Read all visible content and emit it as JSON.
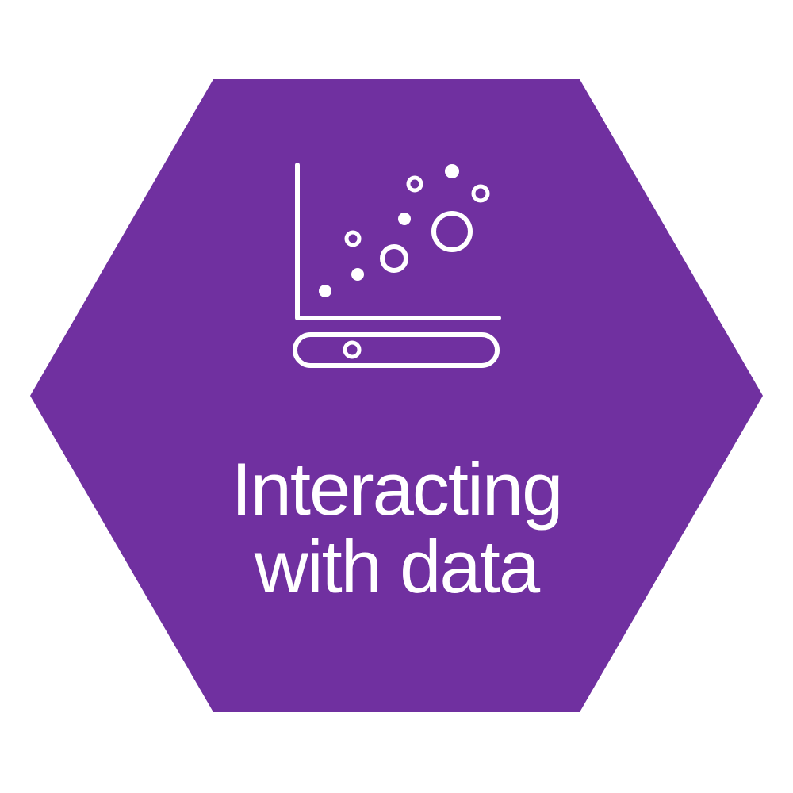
{
  "badge": {
    "color": "#7030a0",
    "icon": "scatter-plot-slider-icon",
    "title_line1": "Interacting",
    "title_line2": "with data"
  }
}
